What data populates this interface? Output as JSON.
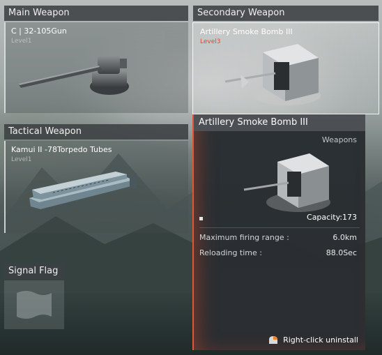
{
  "main_weapon": {
    "header": "Main Weapon",
    "name": "C | 32-105Gun",
    "level": "Level1"
  },
  "secondary_weapon": {
    "header": "Secondary Weapon",
    "name": "Artillery Smoke Bomb III",
    "level": "Level3"
  },
  "tactical_weapon": {
    "header": "Tactical Weapon",
    "name": "Kamui II -78Torpedo Tubes",
    "level": "Level1"
  },
  "signal_flag": {
    "header": "Signal Flag"
  },
  "tooltip": {
    "title": "Artillery Smoke Bomb III",
    "category": "Weapons",
    "capacity": "Capacity:173",
    "stats": [
      {
        "label": "Maximum firing range :",
        "value": "6.0km"
      },
      {
        "label": "Reloading time :",
        "value": "88.0Sec"
      }
    ],
    "footer_hint": "Right-click uninstall",
    "footer_icon": "mouse-right-click-icon"
  },
  "colors": {
    "accent_red": "#e9432f",
    "tooltip_border": "#e1563a"
  }
}
